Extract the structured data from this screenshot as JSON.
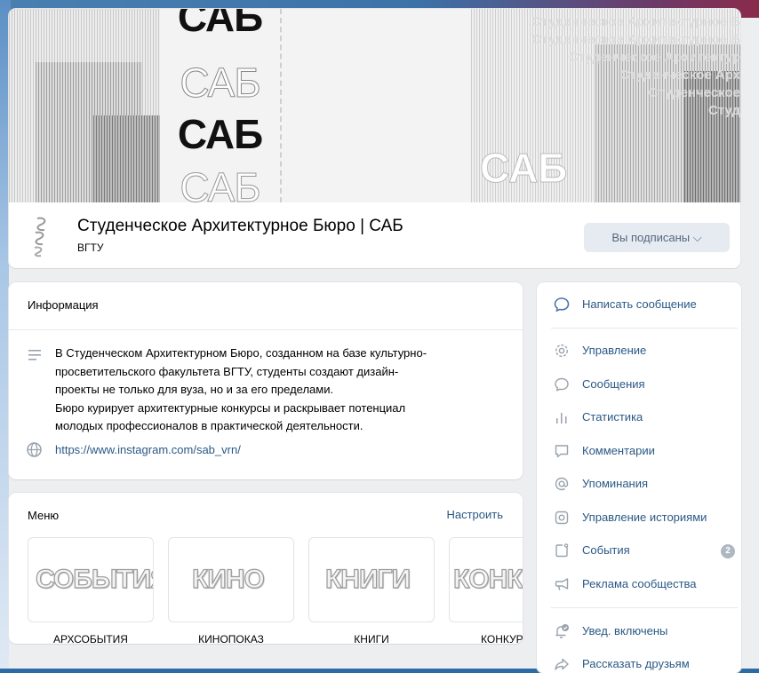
{
  "cover": {
    "words": [
      "САБ",
      "САБ",
      "САБ",
      "САБ"
    ],
    "ghost_lines": [
      "Студенческое Архитектурное Б",
      "Студенческое Архитектурное Б",
      "Студенческое Архитектур",
      "Студенческое Арх",
      "Студенческое",
      "Студ"
    ],
    "right_word": "САБ"
  },
  "group": {
    "title": "Студенческое Архитектурное Бюро | САБ",
    "subtitle": "ВГТУ",
    "subscribe_button": "Вы подписаны ⌵"
  },
  "info": {
    "heading": "Информация",
    "description": [
      "В Студенческом Архитектурном Бюро, созданном на базе культурно-",
      "просветительского факультета ВГТУ, студенты создают дизайн-",
      "проекты не только для вуза, но и за его пределами.",
      "Бюро курирует архитектурные конкурсы и раскрывает потенциал",
      "молодых профессионалов в практической деятельности."
    ],
    "link": "https://www.instagram.com/sab_vrn/"
  },
  "menu": {
    "heading": "Меню",
    "configure": "Настроить",
    "tiles": [
      {
        "image_text": "СОБЫТИЯ",
        "caption": "АРХСОБЫТИЯ"
      },
      {
        "image_text": "КИНО",
        "caption": "КИНОПОКАЗ"
      },
      {
        "image_text": "КНИГИ",
        "caption": "КНИГИ"
      },
      {
        "image_text": "КОНК",
        "caption": "КОНКУР"
      }
    ]
  },
  "side": {
    "write_message": "Написать сообщение",
    "items": [
      {
        "label": "Управление",
        "icon": "gear-icon"
      },
      {
        "label": "Сообщения",
        "icon": "message-icon"
      },
      {
        "label": "Статистика",
        "icon": "stats-icon"
      },
      {
        "label": "Комментарии",
        "icon": "comments-icon"
      },
      {
        "label": "Упоминания",
        "icon": "mention-icon"
      },
      {
        "label": "Управление историями",
        "icon": "stories-icon"
      },
      {
        "label": "События",
        "icon": "calendar-icon",
        "badge": "2"
      },
      {
        "label": "Реклама сообщества",
        "icon": "megaphone-icon"
      }
    ],
    "notifications": "Увед. включены",
    "share": "Рассказать друзьям"
  },
  "colors": {
    "link": "#2a5885",
    "button_bg": "#e5ebf1",
    "page_bg": "#edeef0"
  }
}
